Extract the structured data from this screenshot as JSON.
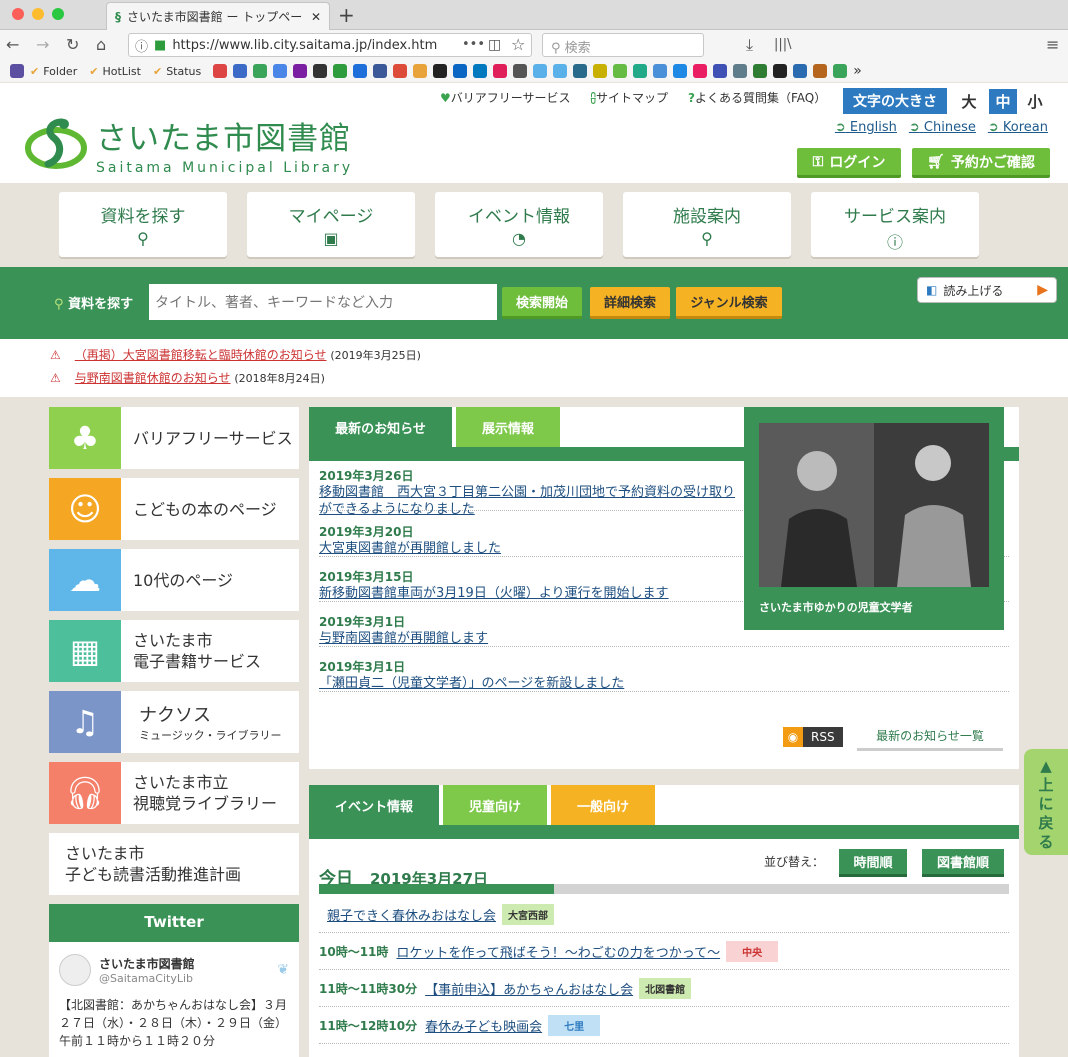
{
  "browser": {
    "tab_title": "さいたま市図書館 ー トップペー",
    "url": "https://www.lib.city.saitama.jp/index.htm",
    "search_placeholder": "検索",
    "bookmarks": [
      "Folder",
      "HotList",
      "Status"
    ]
  },
  "header": {
    "logo_jp": "さいたま市図書館",
    "logo_en": "Saitama Municipal Library",
    "top_links": [
      "バリアフリーサービス",
      "サイトマップ",
      "よくある質問集（FAQ）"
    ],
    "font_size_label": "文字の大きさ",
    "font_sizes": [
      "大",
      "中",
      "小"
    ],
    "languages": [
      "English",
      "Chinese",
      "Korean"
    ],
    "login": "ログイン",
    "reservation": "予約かご確認"
  },
  "main_nav": [
    {
      "label": "資料を探す",
      "icon": "search-icon",
      "glyph": "⚲"
    },
    {
      "label": "マイページ",
      "icon": "lock-icon",
      "glyph": "🔒︎"
    },
    {
      "label": "イベント情報",
      "icon": "clock-icon",
      "glyph": "◔"
    },
    {
      "label": "施設案内",
      "icon": "map-pin-icon",
      "glyph": "⚲"
    },
    {
      "label": "サービス案内",
      "icon": "info-icon",
      "glyph": "ⓘ"
    }
  ],
  "search": {
    "label": "資料を探す",
    "placeholder": "タイトル、著者、キーワードなど入力",
    "submit": "検索開始",
    "detail": "詳細検索",
    "genre": "ジャンル検索",
    "read_aloud": "読み上げる"
  },
  "notices": [
    {
      "text": "（再掲）大宮図書館移転と臨時休館のお知らせ",
      "date": "(2019年3月25日)"
    },
    {
      "text": "与野南図書館休館のお知らせ",
      "date": "(2018年8月24日)"
    }
  ],
  "sidebar": [
    {
      "label": "バリアフリーサービス",
      "color": "#8fd14f"
    },
    {
      "label": "こどもの本のページ",
      "color": "#f5a623"
    },
    {
      "label": "10代のページ",
      "color": "#5fb6e8"
    },
    {
      "label": "さいたま市\n電子書籍サービス",
      "color": "#4dbf9a"
    },
    {
      "label": "ナクソス",
      "sub": "ミュージック・ライブラリー",
      "color": "#7b95c8"
    },
    {
      "label": "さいたま市立\n視聴覚ライブラリー",
      "color": "#f4806a"
    },
    {
      "label": "さいたま市\n子ども読書活動推進計画",
      "color": "#ffffff"
    }
  ],
  "twitter": {
    "title": "Twitter",
    "account_name": "さいたま市図書館",
    "handle": "@SaitamaCityLib",
    "tweet": "【北図書館：あかちゃんおはなし会】３月２７日（水）・２８日（木）・２９日（金）午前１１時から１１時２０分"
  },
  "news": {
    "tabs": [
      "最新のお知らせ",
      "展示情報"
    ],
    "items": [
      {
        "date": "2019年3月26日",
        "title": "移動図書館　西大宮３丁目第二公園・加茂川団地で予約資料の受け取りができるようになりました"
      },
      {
        "date": "2019年3月20日",
        "title": "大宮東図書館が再開館しました"
      },
      {
        "date": "2019年3月15日",
        "title": "新移動図書館車両が3月19日（火曜）より運行を開始します"
      },
      {
        "date": "2019年3月1日",
        "title": "与野南図書館が再開館します"
      },
      {
        "date": "2019年3月1日",
        "title": "「瀬田貞二（児童文学者）」のページを新設しました"
      }
    ],
    "rss": "RSS",
    "all_link": "最新のお知らせ一覧"
  },
  "feature": {
    "caption": "さいたま市ゆかりの児童文学者"
  },
  "events": {
    "tabs": [
      "イベント情報",
      "児童向け",
      "一般向け"
    ],
    "sort_label": "並び替え：",
    "sort_time": "時間順",
    "sort_library": "図書館順",
    "today_label": "今日",
    "today_date": "2019年3月27日",
    "items": [
      {
        "time": "",
        "title": "親子できく春休みおはなし会",
        "tag": "大宮西部",
        "tag_color": "#cdeab0"
      },
      {
        "time": "10時～11時",
        "title": "ロケットを作って飛ばそう！～わごむの力をつかって～",
        "tag": "中央",
        "tag_color": "#f9d3d3"
      },
      {
        "time": "11時～11時30分",
        "title": "【事前申込】あかちゃんおはなし会",
        "tag": "北図書館",
        "tag_color": "#cdeab0"
      },
      {
        "time": "11時～12時10分",
        "title": "春休み子ども映画会",
        "tag": "七里",
        "tag_color": "#bfe0f5"
      }
    ]
  },
  "back_to_top": "▲\n上\nに\n戻\nる"
}
